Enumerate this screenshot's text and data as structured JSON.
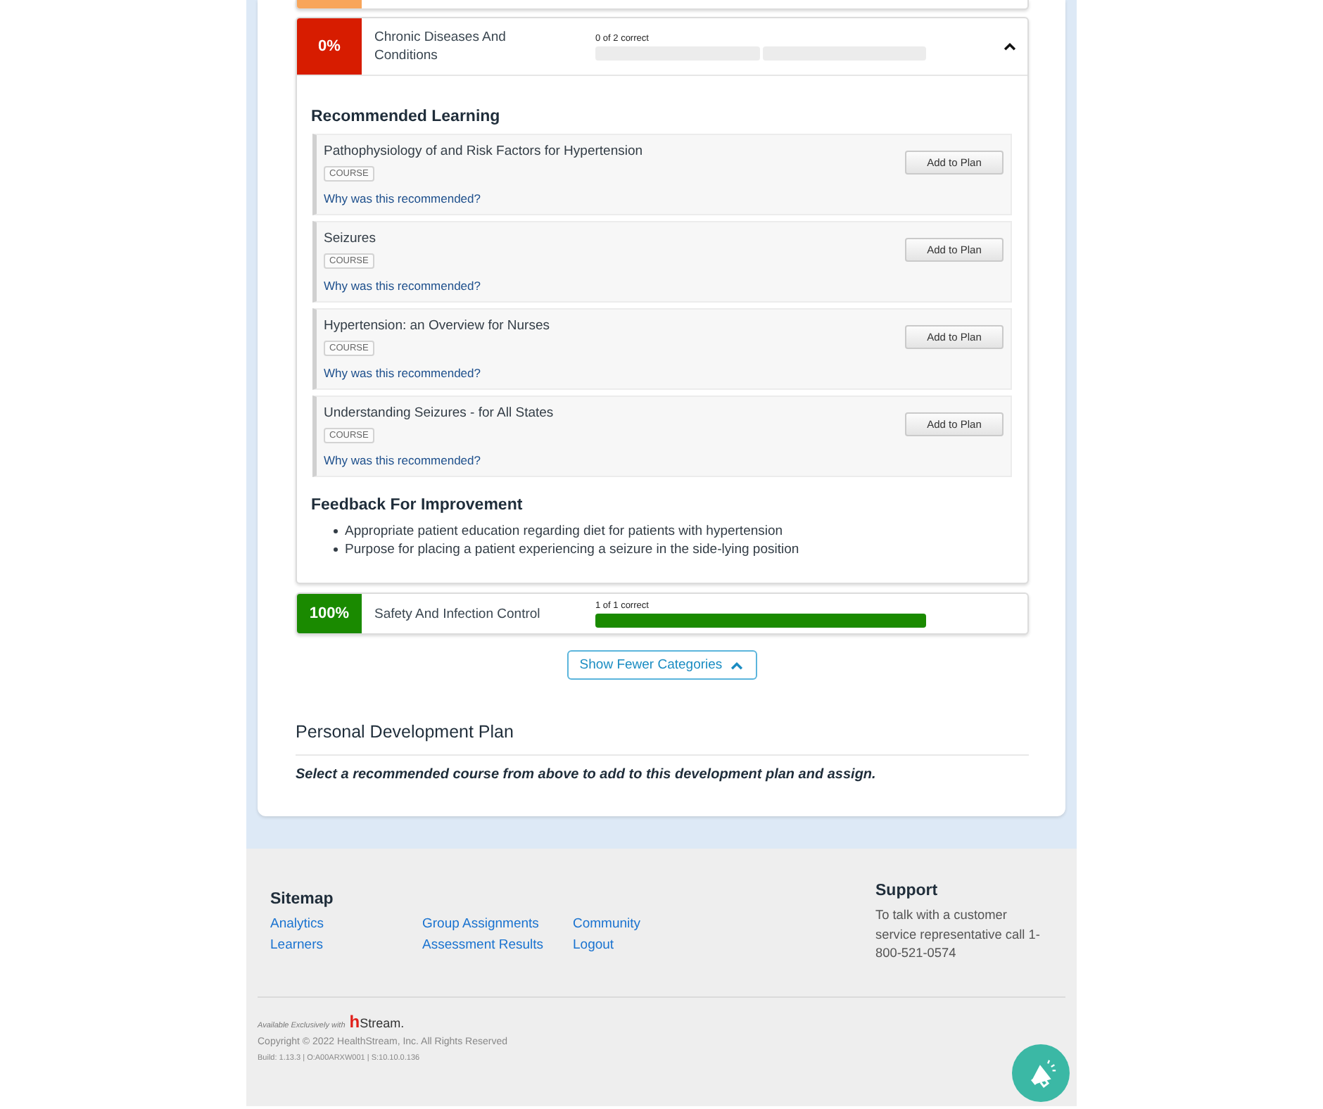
{
  "category_above": {
    "color": "#f8a55a"
  },
  "categories": [
    {
      "percent": "0%",
      "color": "#d71c00",
      "name": "Chronic Diseases And Conditions",
      "score": "0 of 2 correct",
      "segments": [
        {
          "correct": false
        },
        {
          "correct": false
        }
      ],
      "expanded": true,
      "recommended_learning": {
        "title": "Recommended Learning",
        "courses": [
          {
            "title": "Pathophysiology of and Risk Factors for Hypertension",
            "type": "COURSE",
            "why_link": "Why was this recommended?",
            "button": "Add to Plan"
          },
          {
            "title": "Seizures",
            "type": "COURSE",
            "why_link": "Why was this recommended?",
            "button": "Add to Plan"
          },
          {
            "title": "Hypertension: an Overview for Nurses",
            "type": "COURSE",
            "why_link": "Why was this recommended?",
            "button": "Add to Plan"
          },
          {
            "title": "Understanding Seizures - for All States",
            "type": "COURSE",
            "why_link": "Why was this recommended?",
            "button": "Add to Plan"
          }
        ]
      },
      "feedback": {
        "title": "Feedback For Improvement",
        "items": [
          "Appropriate patient education regarding diet for patients with hypertension",
          "Purpose for placing a patient experiencing a seizure in the side-lying position"
        ]
      }
    },
    {
      "percent": "100%",
      "color": "#1a8a00",
      "name": "Safety And Infection Control",
      "score": "1 of 1 correct",
      "segments": [
        {
          "correct": true
        }
      ],
      "expanded": false
    }
  ],
  "show_fewer_button": "Show Fewer Categories",
  "development_plan": {
    "title": "Personal Development Plan",
    "instruction": "Select a recommended course from above to add to this development plan and assign."
  },
  "footer": {
    "sitemap": {
      "title": "Sitemap",
      "columns": [
        [
          "Analytics",
          "Learners"
        ],
        [
          "Group Assignments",
          "Assessment Results"
        ],
        [
          "Community",
          "Logout"
        ]
      ]
    },
    "support": {
      "title": "Support",
      "text": "To talk with a customer service representative call 1-800-521-0574"
    },
    "brand": {
      "tagline": "Available Exclusively with",
      "logo_mark": "h",
      "logo_text": "Stream."
    },
    "copyright": "Copyright © 2022 HealthStream, Inc. All Rights Reserved",
    "build": "Build: 1.13.3 | O:A00ARXW001 | S:10.10.0.136"
  }
}
